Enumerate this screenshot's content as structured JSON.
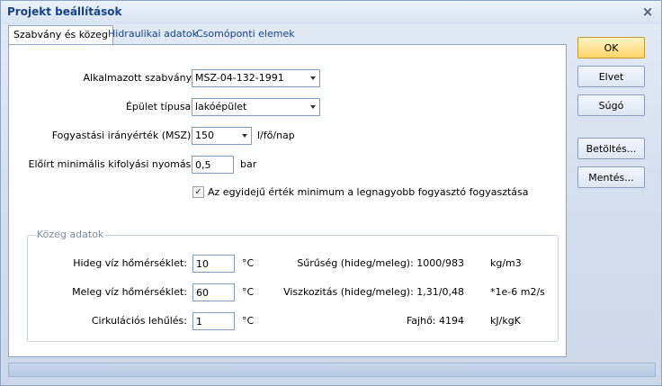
{
  "window": {
    "title": "Projekt beállítások"
  },
  "tabs": [
    "Szabvány és közeg",
    "Hidraulikai adatok",
    "Csomóponti elemek"
  ],
  "standard": {
    "label": "Alkalmazott szabvány:",
    "value": "MSZ-04-132-1991"
  },
  "building": {
    "label": "Épület típusa:",
    "value": "lakóépület"
  },
  "consumption": {
    "label": "Fogyastási irányérték (MSZ):",
    "value": "150",
    "unit": "l/fő/nap"
  },
  "pressure": {
    "label": "Előírt minimális kifolyási nyomás:",
    "value": "0,5",
    "unit": "bar"
  },
  "checkbox": {
    "checked": true,
    "label": "Az egyidejű érték minimum a legnagyobb fogyasztó fogyasztása"
  },
  "medium": {
    "title": "Közeg adatok",
    "cold": {
      "label": "Hideg víz hőmérséklet:",
      "value": "10",
      "unit": "°C"
    },
    "warm": {
      "label": "Meleg víz hőmérséklet:",
      "value": "60",
      "unit": "°C"
    },
    "circ": {
      "label": "Cirkulációs lehűlés:",
      "value": "1",
      "unit": "°C"
    },
    "density": {
      "label": "Sűrűség (hideg/meleg): 1000/983",
      "unit": "kg/m3"
    },
    "viscosity": {
      "label": "Viszkozitás (hideg/meleg): 1,31/0,48",
      "unit": "*1e-6 m2/s"
    },
    "heat": {
      "label": "Fajhő: 4194",
      "unit": "kJ/kgK"
    }
  },
  "buttons": {
    "ok": "OK",
    "cancel": "Elvet",
    "help": "Súgó",
    "load": "Betöltés...",
    "save": "Mentés..."
  }
}
